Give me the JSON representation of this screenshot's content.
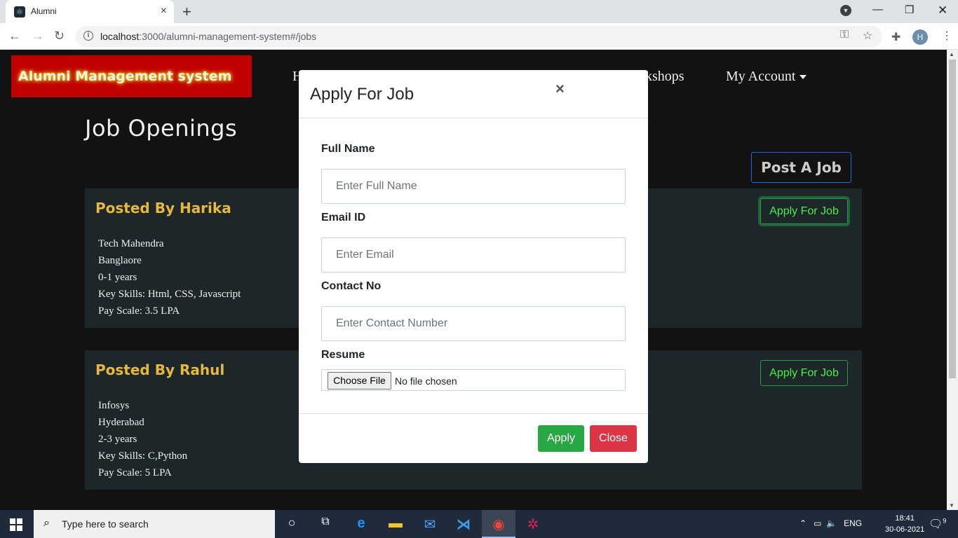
{
  "browser": {
    "tab_title": "Alumni",
    "tab_close": "×",
    "new_tab": "+",
    "url_host": "localhost",
    "url_rest": ":3000/alumni-management-system#/jobs",
    "avatar_letter": "H",
    "icons": [
      "back-icon",
      "forward-icon",
      "reload-icon",
      "info-icon",
      "key-icon",
      "star-icon",
      "extensions-icon",
      "chevron-down-icon",
      "minimize-icon",
      "maximize-icon",
      "close-icon"
    ]
  },
  "navbar": {
    "brand": "Alumni Management system",
    "link_partial_left": "H",
    "link_partial_right": "kshops",
    "my_account": "My Account"
  },
  "main": {
    "heading": "Job Openings",
    "post_job": "Post A Job",
    "jobs": [
      {
        "posted_by": "Posted By Harika",
        "company": "Tech Mahendra",
        "location": "Banglaore",
        "experience": "0-1 years",
        "skills": "Key Skills: Html, CSS, Javascript",
        "pay": "Pay Scale: 3.5 LPA",
        "apply_label": "Apply For Job"
      },
      {
        "posted_by": "Posted By Rahul",
        "company": "Infosys",
        "location": "Hyderabad",
        "experience": "2-3 years",
        "skills": "Key Skills: C,Python",
        "pay": "Pay Scale: 5 LPA",
        "apply_label": "Apply For Job"
      }
    ]
  },
  "modal": {
    "title": "Apply For Job",
    "close_x": "×",
    "full_name_label": "Full Name",
    "full_name_placeholder": "Enter Full Name",
    "email_label": "Email ID",
    "email_placeholder": "Enter Email",
    "contact_label": "Contact No",
    "contact_placeholder": "Enter Contact Number",
    "resume_label": "Resume",
    "choose_file": "Choose File",
    "no_file": "No file chosen",
    "apply": "Apply",
    "close": "Close"
  },
  "taskbar": {
    "search_placeholder": "Type here to search",
    "lang": "ENG",
    "time": "18:41",
    "date": "30-06-2021",
    "notifications": "9"
  },
  "colors": {
    "page_bg": "#141414",
    "card_bg": "#1f2a2c",
    "poster": "#f6c344",
    "brand_bg": "#cc0000",
    "success": "#28a745",
    "danger": "#dc3545",
    "primary": "#0d6efd"
  }
}
